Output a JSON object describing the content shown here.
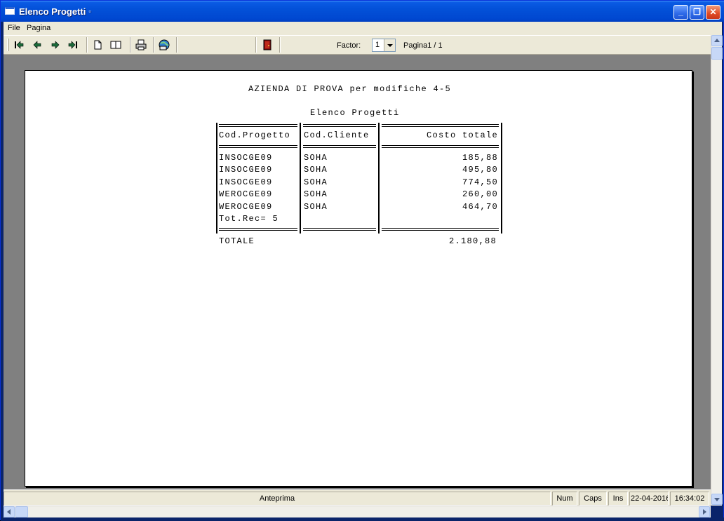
{
  "window": {
    "title": "Elenco Progetti",
    "title_mark": "▫"
  },
  "caption_buttons": {
    "minimize": "_",
    "maximize": "❐",
    "close": "✕"
  },
  "menu": {
    "items": [
      "File",
      "Pagina"
    ]
  },
  "toolbar": {
    "buttons": [
      "first-page-icon",
      "previous-page-icon",
      "next-page-icon",
      "last-page-icon",
      "single-page-icon",
      "two-pages-icon",
      "print-icon",
      "export-icon",
      "exit-door-icon"
    ],
    "factor_label": "Factor:",
    "factor_value": "1",
    "page_info": "Pagina1 / 1"
  },
  "report": {
    "company": "AZIENDA DI PROVA per modifiche 4-5",
    "title": "Elenco Progetti",
    "columns": [
      "Cod.Progetto",
      "Cod.Cliente",
      "Costo totale"
    ],
    "rows": [
      [
        "INSOCGE09",
        "SOHA",
        "185,88"
      ],
      [
        "INSOCGE09",
        "SOHA",
        "495,80"
      ],
      [
        "INSOCGE09",
        "SOHA",
        "774,50"
      ],
      [
        "WEROCGE09",
        "SOHA",
        "260,00"
      ],
      [
        "WEROCGE09",
        "SOHA",
        "464,70"
      ]
    ],
    "record_count": "Tot.Rec= 5",
    "total_label": "TOTALE",
    "total_value": "2.180,88"
  },
  "status": {
    "message": "Anteprima",
    "num": "Num",
    "caps": "Caps",
    "ins": "Ins",
    "date": "22-04-2016",
    "time": "16:34:02"
  },
  "colors": {
    "titlebar": "#0351d8",
    "chrome": "#ece9d8",
    "workspace": "#808080"
  }
}
